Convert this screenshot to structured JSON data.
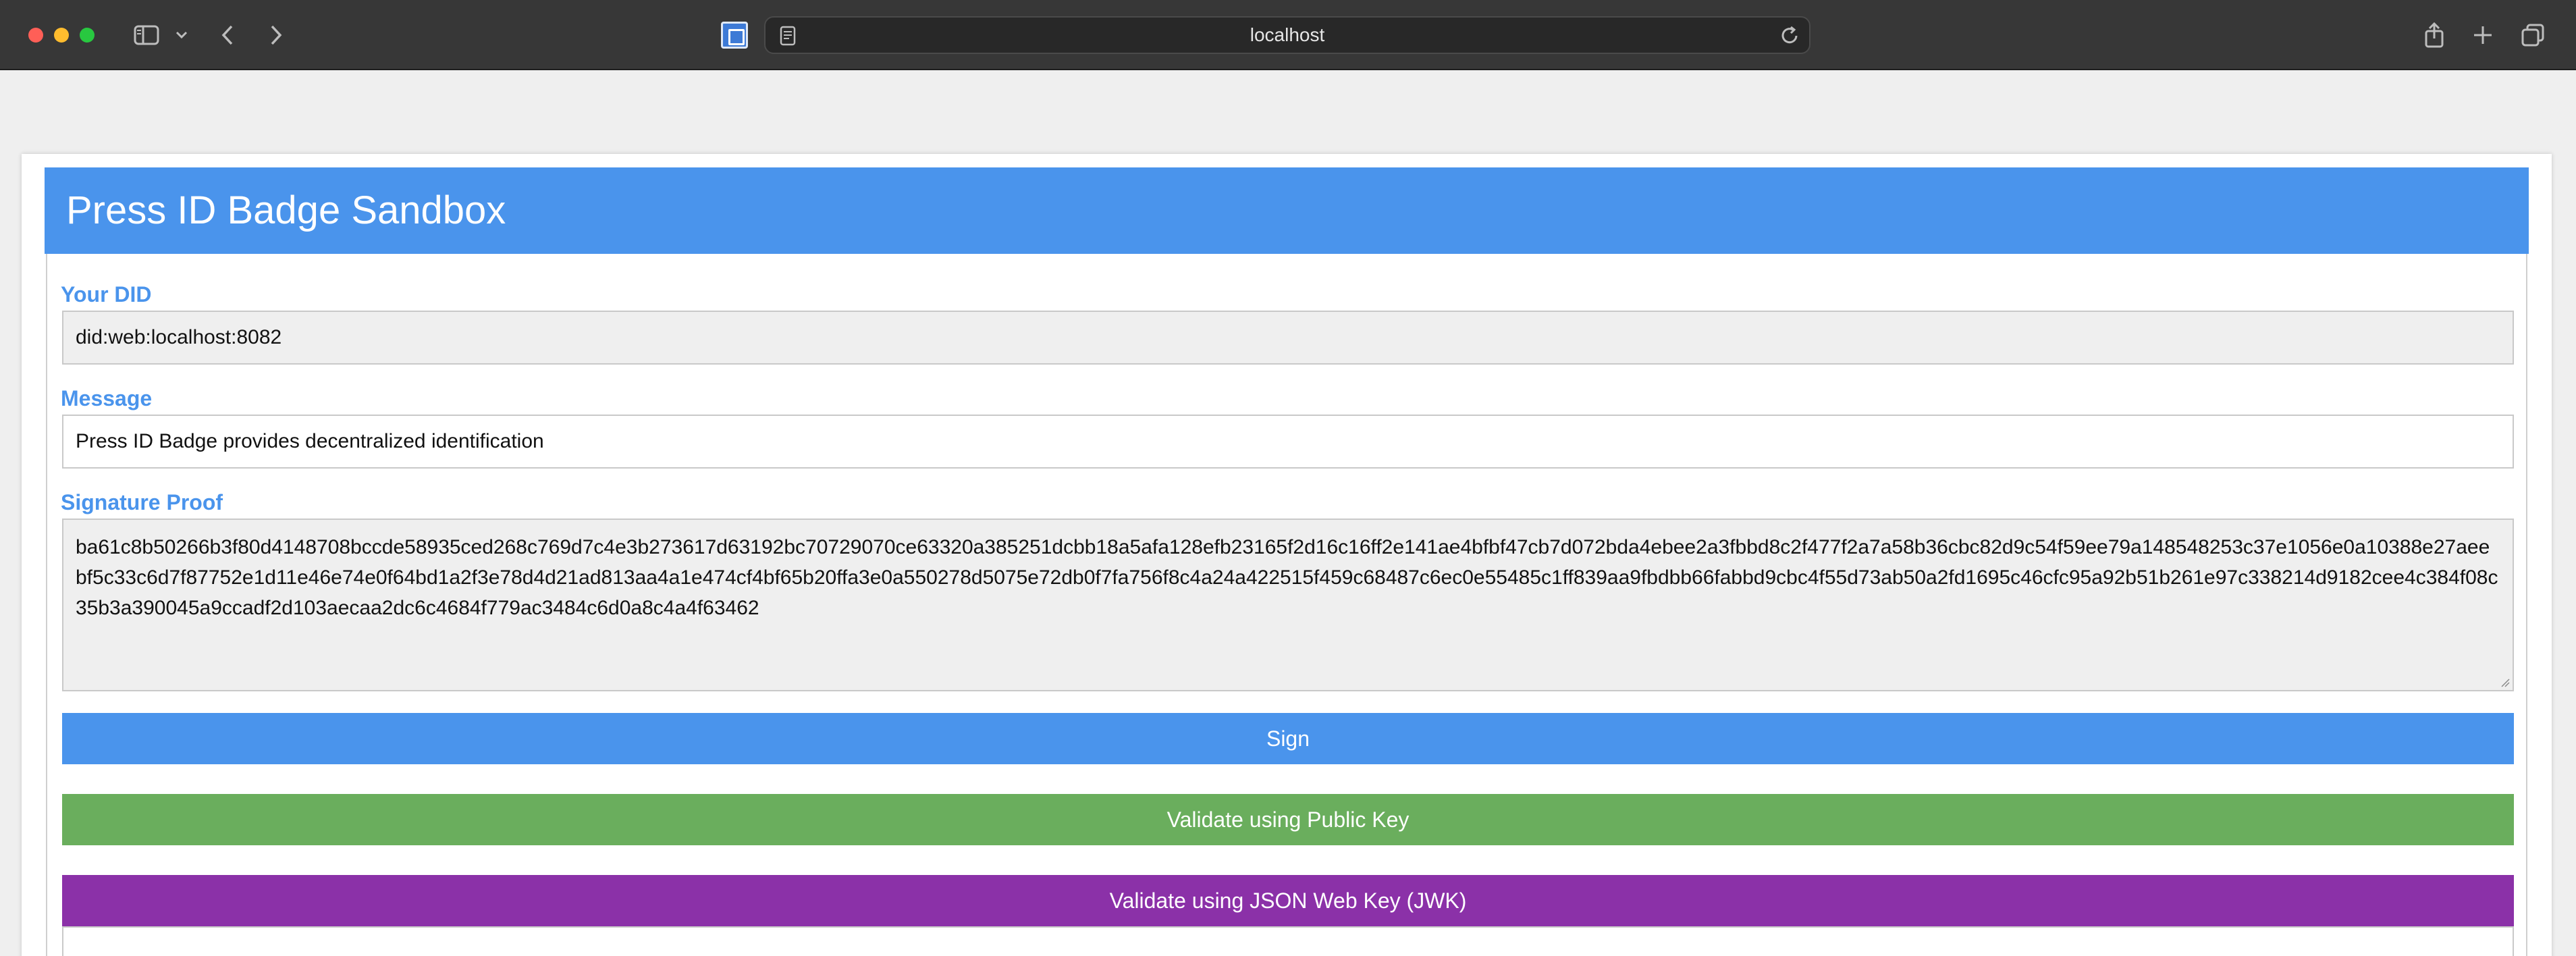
{
  "browser": {
    "url": "localhost",
    "icons": {
      "sidebar": "sidebar-icon",
      "chevron": "chevron-down-icon",
      "back": "back-icon",
      "forward": "forward-icon",
      "reader": "reader-icon",
      "reload": "reload-icon",
      "share": "share-icon",
      "new_tab": "plus-icon",
      "tabs": "tabs-overview-icon"
    }
  },
  "app": {
    "title": "Press ID Badge Sandbox"
  },
  "form": {
    "did_label": "Your DID",
    "did_value": "did:web:localhost:8082",
    "message_label": "Message",
    "message_value": "Press ID Badge provides decentralized identification",
    "signature_label": "Signature Proof",
    "signature_value": "ba61c8b50266b3f80d4148708bccde58935ced268c769d7c4e3b273617d63192bc70729070ce63320a385251dcbb18a5afa128efb23165f2d16c16ff2e141ae4bfbf47cb7d072bda4ebee2a3fbbd8c2f477f2a7a58b36cbc82d9c54f59ee79a148548253c37e1056e0a10388e27aeebf5c33c6d7f87752e1d11e46e74e0f64bd1a2f3e78d4d21ad813aa4a1e474cf4bf65b20ffa3e0a550278d5075e72db0f7fa756f8c4a24a422515f459c68487c6ec0e55485c1ff839aa9fbdbb66fabbd9cbc4f55d73ab50a2fd1695c46cfc95a92b51b261e97c338214d9182cee4c384f08c35b3a390045a9ccadf2d103aecaa2dc6c4684f779ac3484c6d0a8c4a4f63462"
  },
  "buttons": {
    "sign": "Sign",
    "validate_public_key": "Validate using Public Key",
    "validate_jwk": "Validate using JSON Web Key (JWK)"
  },
  "colors": {
    "header": "#4a94ec",
    "sign": "#4a94ec",
    "validate_public_key": "#6aae5d",
    "validate_jwk": "#8b31a8"
  }
}
